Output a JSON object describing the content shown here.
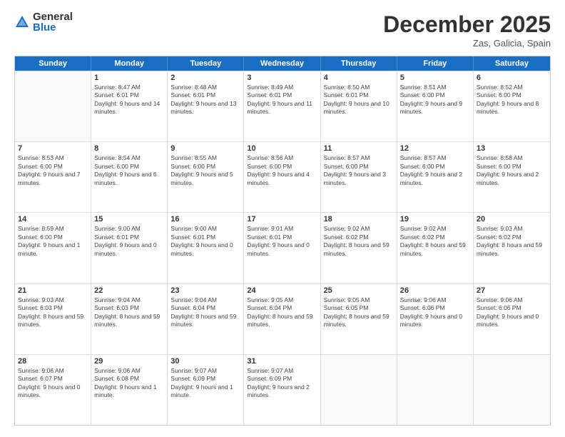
{
  "logo": {
    "general": "General",
    "blue": "Blue"
  },
  "header": {
    "month": "December 2025",
    "location": "Zas, Galicia, Spain"
  },
  "weekdays": [
    "Sunday",
    "Monday",
    "Tuesday",
    "Wednesday",
    "Thursday",
    "Friday",
    "Saturday"
  ],
  "weeks": [
    [
      {
        "day": "",
        "sunrise": "",
        "sunset": "",
        "daylight": "",
        "empty": true
      },
      {
        "day": "1",
        "sunrise": "Sunrise: 8:47 AM",
        "sunset": "Sunset: 6:01 PM",
        "daylight": "Daylight: 9 hours and 14 minutes."
      },
      {
        "day": "2",
        "sunrise": "Sunrise: 8:48 AM",
        "sunset": "Sunset: 6:01 PM",
        "daylight": "Daylight: 9 hours and 13 minutes."
      },
      {
        "day": "3",
        "sunrise": "Sunrise: 8:49 AM",
        "sunset": "Sunset: 6:01 PM",
        "daylight": "Daylight: 9 hours and 11 minutes."
      },
      {
        "day": "4",
        "sunrise": "Sunrise: 8:50 AM",
        "sunset": "Sunset: 6:01 PM",
        "daylight": "Daylight: 9 hours and 10 minutes."
      },
      {
        "day": "5",
        "sunrise": "Sunrise: 8:51 AM",
        "sunset": "Sunset: 6:00 PM",
        "daylight": "Daylight: 9 hours and 9 minutes."
      },
      {
        "day": "6",
        "sunrise": "Sunrise: 8:52 AM",
        "sunset": "Sunset: 6:00 PM",
        "daylight": "Daylight: 9 hours and 8 minutes."
      }
    ],
    [
      {
        "day": "7",
        "sunrise": "Sunrise: 8:53 AM",
        "sunset": "Sunset: 6:00 PM",
        "daylight": "Daylight: 9 hours and 7 minutes."
      },
      {
        "day": "8",
        "sunrise": "Sunrise: 8:54 AM",
        "sunset": "Sunset: 6:00 PM",
        "daylight": "Daylight: 9 hours and 6 minutes."
      },
      {
        "day": "9",
        "sunrise": "Sunrise: 8:55 AM",
        "sunset": "Sunset: 6:00 PM",
        "daylight": "Daylight: 9 hours and 5 minutes."
      },
      {
        "day": "10",
        "sunrise": "Sunrise: 8:56 AM",
        "sunset": "Sunset: 6:00 PM",
        "daylight": "Daylight: 9 hours and 4 minutes."
      },
      {
        "day": "11",
        "sunrise": "Sunrise: 8:57 AM",
        "sunset": "Sunset: 6:00 PM",
        "daylight": "Daylight: 9 hours and 3 minutes."
      },
      {
        "day": "12",
        "sunrise": "Sunrise: 8:57 AM",
        "sunset": "Sunset: 6:00 PM",
        "daylight": "Daylight: 9 hours and 2 minutes."
      },
      {
        "day": "13",
        "sunrise": "Sunrise: 8:58 AM",
        "sunset": "Sunset: 6:00 PM",
        "daylight": "Daylight: 9 hours and 2 minutes."
      }
    ],
    [
      {
        "day": "14",
        "sunrise": "Sunrise: 8:59 AM",
        "sunset": "Sunset: 6:00 PM",
        "daylight": "Daylight: 9 hours and 1 minute."
      },
      {
        "day": "15",
        "sunrise": "Sunrise: 9:00 AM",
        "sunset": "Sunset: 6:01 PM",
        "daylight": "Daylight: 9 hours and 0 minutes."
      },
      {
        "day": "16",
        "sunrise": "Sunrise: 9:00 AM",
        "sunset": "Sunset: 6:01 PM",
        "daylight": "Daylight: 9 hours and 0 minutes."
      },
      {
        "day": "17",
        "sunrise": "Sunrise: 9:01 AM",
        "sunset": "Sunset: 6:01 PM",
        "daylight": "Daylight: 9 hours and 0 minutes."
      },
      {
        "day": "18",
        "sunrise": "Sunrise: 9:02 AM",
        "sunset": "Sunset: 6:02 PM",
        "daylight": "Daylight: 8 hours and 59 minutes."
      },
      {
        "day": "19",
        "sunrise": "Sunrise: 9:02 AM",
        "sunset": "Sunset: 6:02 PM",
        "daylight": "Daylight: 8 hours and 59 minutes."
      },
      {
        "day": "20",
        "sunrise": "Sunrise: 9:03 AM",
        "sunset": "Sunset: 6:02 PM",
        "daylight": "Daylight: 8 hours and 59 minutes."
      }
    ],
    [
      {
        "day": "21",
        "sunrise": "Sunrise: 9:03 AM",
        "sunset": "Sunset: 6:03 PM",
        "daylight": "Daylight: 8 hours and 59 minutes."
      },
      {
        "day": "22",
        "sunrise": "Sunrise: 9:04 AM",
        "sunset": "Sunset: 6:03 PM",
        "daylight": "Daylight: 8 hours and 59 minutes."
      },
      {
        "day": "23",
        "sunrise": "Sunrise: 9:04 AM",
        "sunset": "Sunset: 6:04 PM",
        "daylight": "Daylight: 8 hours and 59 minutes."
      },
      {
        "day": "24",
        "sunrise": "Sunrise: 9:05 AM",
        "sunset": "Sunset: 6:04 PM",
        "daylight": "Daylight: 8 hours and 59 minutes."
      },
      {
        "day": "25",
        "sunrise": "Sunrise: 9:05 AM",
        "sunset": "Sunset: 6:05 PM",
        "daylight": "Daylight: 8 hours and 59 minutes."
      },
      {
        "day": "26",
        "sunrise": "Sunrise: 9:06 AM",
        "sunset": "Sunset: 6:06 PM",
        "daylight": "Daylight: 9 hours and 0 minutes."
      },
      {
        "day": "27",
        "sunrise": "Sunrise: 9:06 AM",
        "sunset": "Sunset: 6:06 PM",
        "daylight": "Daylight: 9 hours and 0 minutes."
      }
    ],
    [
      {
        "day": "28",
        "sunrise": "Sunrise: 9:06 AM",
        "sunset": "Sunset: 6:07 PM",
        "daylight": "Daylight: 9 hours and 0 minutes."
      },
      {
        "day": "29",
        "sunrise": "Sunrise: 9:06 AM",
        "sunset": "Sunset: 6:08 PM",
        "daylight": "Daylight: 9 hours and 1 minute."
      },
      {
        "day": "30",
        "sunrise": "Sunrise: 9:07 AM",
        "sunset": "Sunset: 6:09 PM",
        "daylight": "Daylight: 9 hours and 1 minute."
      },
      {
        "day": "31",
        "sunrise": "Sunrise: 9:07 AM",
        "sunset": "Sunset: 6:09 PM",
        "daylight": "Daylight: 9 hours and 2 minutes."
      },
      {
        "day": "",
        "sunrise": "",
        "sunset": "",
        "daylight": "",
        "empty": true
      },
      {
        "day": "",
        "sunrise": "",
        "sunset": "",
        "daylight": "",
        "empty": true
      },
      {
        "day": "",
        "sunrise": "",
        "sunset": "",
        "daylight": "",
        "empty": true
      }
    ]
  ]
}
